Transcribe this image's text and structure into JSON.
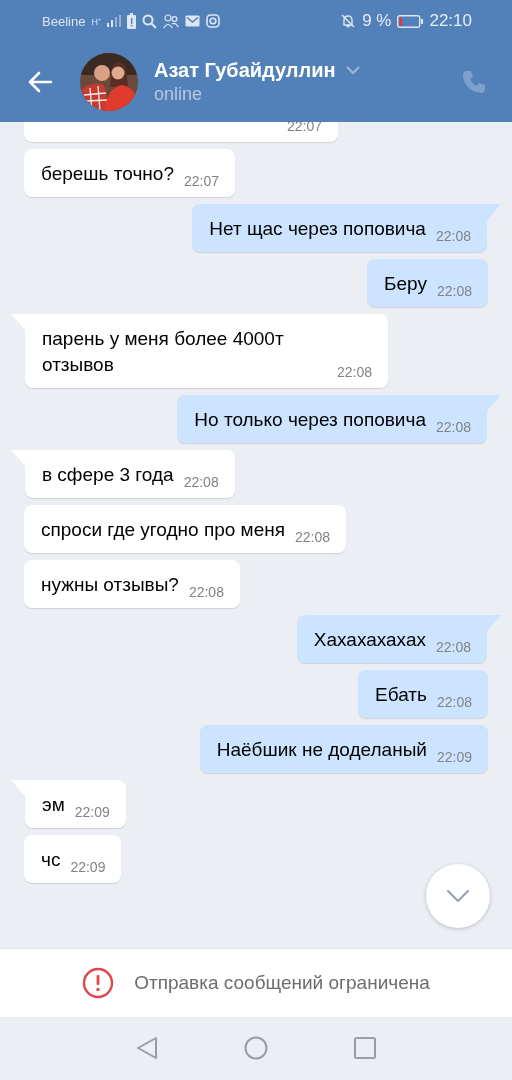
{
  "status_bar": {
    "carrier": "Beeline",
    "network": "H⁺",
    "battery_percent": "9 %",
    "time": "22:10"
  },
  "header": {
    "name": "Азат Губайдуллин",
    "status": "online"
  },
  "messages": [
    {
      "kind": "incoming",
      "time": "22:07"
    },
    {
      "kind": "incoming",
      "tail": false,
      "text": "берешь точно?",
      "time": "22:07"
    },
    {
      "kind": "outgoing",
      "tail": true,
      "text": "Нет щас через поповича",
      "time": "22:08"
    },
    {
      "kind": "outgoing",
      "tail": false,
      "text": "Беру",
      "time": "22:08"
    },
    {
      "kind": "incoming",
      "tail": true,
      "text": "парень у меня более 4000т отзывов",
      "time": "22:08"
    },
    {
      "kind": "outgoing",
      "tail": true,
      "text": "Но только через поповича",
      "time": "22:08"
    },
    {
      "kind": "incoming",
      "tail": true,
      "text": "в сфере 3 года",
      "time": "22:08"
    },
    {
      "kind": "incoming",
      "tail": false,
      "text": "спроси где угодно про меня",
      "time": "22:08"
    },
    {
      "kind": "incoming",
      "tail": false,
      "text": "нужны отзывы?",
      "time": "22:08"
    },
    {
      "kind": "outgoing",
      "tail": true,
      "text": "Хахахахахах",
      "time": "22:08"
    },
    {
      "kind": "outgoing",
      "tail": false,
      "text": "Ебать",
      "time": "22:08"
    },
    {
      "kind": "outgoing",
      "tail": false,
      "text": "Наёбшик не доделаный",
      "time": "22:09"
    },
    {
      "kind": "incoming",
      "tail": true,
      "text": "эм",
      "time": "22:09"
    },
    {
      "kind": "incoming",
      "tail": false,
      "text": "чс",
      "time": "22:09"
    }
  ],
  "notice": {
    "text": "Отправка сообщений ограничена"
  }
}
